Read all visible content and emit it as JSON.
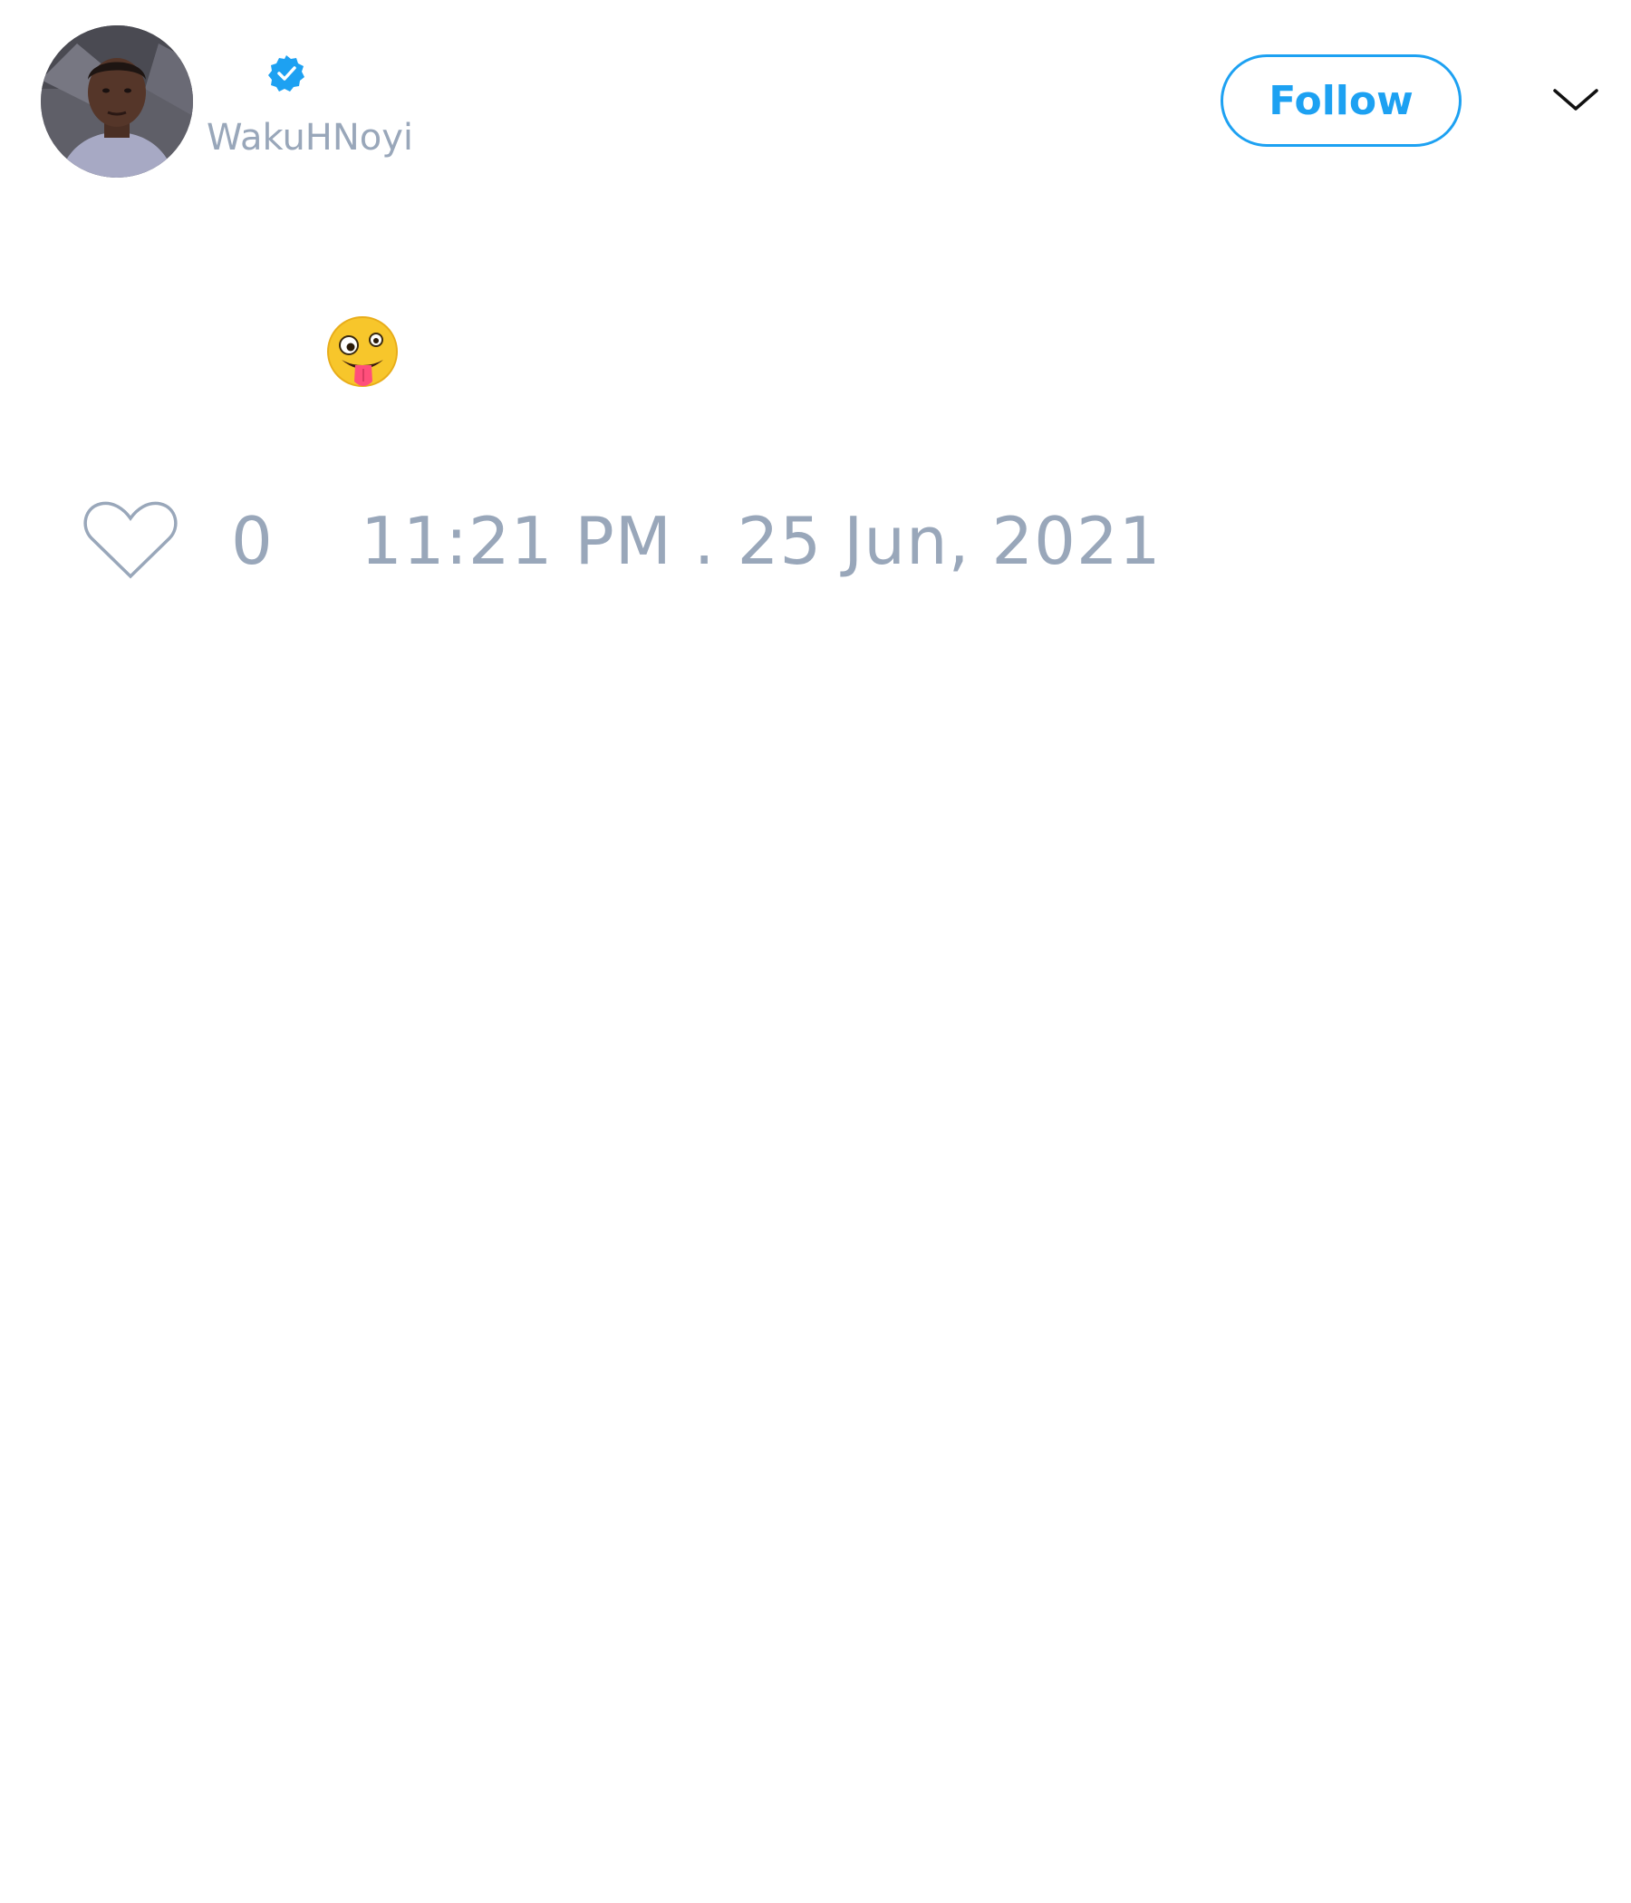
{
  "author": {
    "handle": "WakuHNoyi",
    "verified": true
  },
  "header": {
    "follow_label": "Follow",
    "menu_icon": "chevron-down-icon"
  },
  "tweet": {
    "content_emoji": "zany-face-emoji"
  },
  "footer": {
    "like_icon": "heart-icon",
    "like_count": "0",
    "timestamp": "11:21 PM . 25 Jun, 2021"
  },
  "colors": {
    "accent": "#1da1f2",
    "muted_text": "#99a7ba",
    "background": "#ffffff"
  }
}
